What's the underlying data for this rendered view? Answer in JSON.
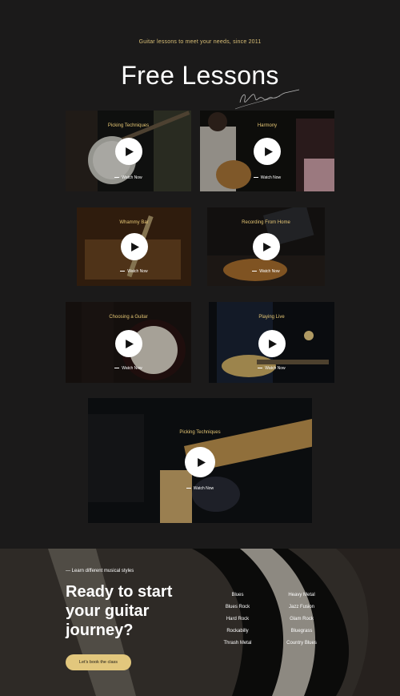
{
  "hero": {
    "tagline": "Guitar lessons to meet your needs, since 2011",
    "title": "Free Lessons"
  },
  "lessons": [
    {
      "title": "Picking Techniques",
      "watch": "Watch Now"
    },
    {
      "title": "Harmony",
      "watch": "Watch Now"
    },
    {
      "title": "Whammy Bar",
      "watch": "Watch Now"
    },
    {
      "title": "Recording From Home",
      "watch": "Watch Now"
    },
    {
      "title": "Choosing a Guitar",
      "watch": "Watch Now"
    },
    {
      "title": "Playing Live",
      "watch": "Watch Now"
    },
    {
      "title": "Picking Techniques",
      "watch": "Watch Now"
    }
  ],
  "cta": {
    "styles_label": "— Learn different musical styles",
    "title": "Ready to start your guitar journey?",
    "button": "Let's book the class",
    "styles": [
      "Blues",
      "Heavy Metal",
      "Blues Rock",
      "Jazz Fusion",
      "Hard Rock",
      "Glam Rock",
      "Rockabilly",
      "Bluegrass",
      "Thrash Metal",
      "Country Blues"
    ]
  },
  "colors": {
    "accent": "#e2c77d",
    "background": "#1b1a1a"
  },
  "icons": {
    "play": "play-icon"
  }
}
